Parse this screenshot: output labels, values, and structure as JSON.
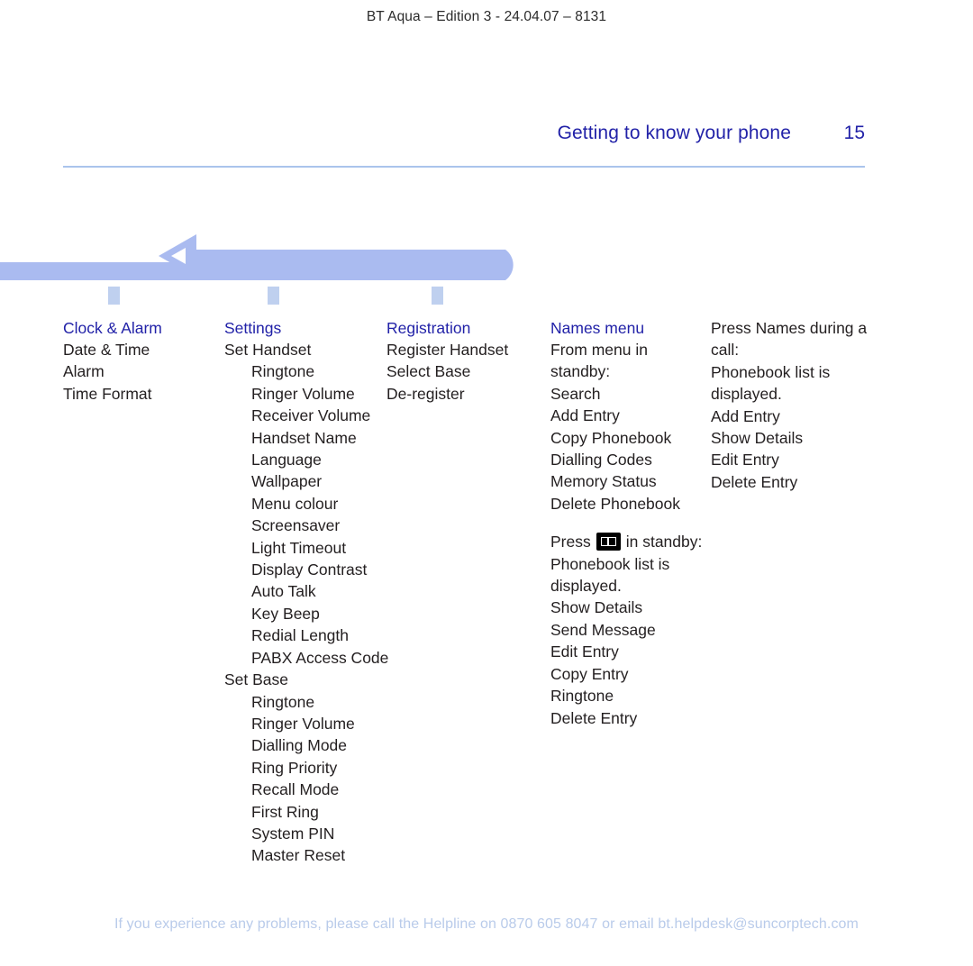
{
  "running_head": "BT Aqua – Edition 3 -  24.04.07 – 8131",
  "header": {
    "chapter_title": "Getting to know your phone",
    "page_number": "15"
  },
  "colors": {
    "heading_blue": "#2222a8",
    "rule_blue": "#aac4ec",
    "arrow_blue": "#aabbf0",
    "tick_blue": "#bfd0ef",
    "footer_blue": "#b9cbea",
    "body_text": "#231f20"
  },
  "columns": [
    {
      "heading": "Clock & Alarm",
      "items": [
        {
          "label": "Date & Time",
          "indent": 0
        },
        {
          "label": "Alarm",
          "indent": 0
        },
        {
          "label": "Time Format",
          "indent": 0
        }
      ]
    },
    {
      "heading": "Settings",
      "items": [
        {
          "label": "Set Handset",
          "indent": 0
        },
        {
          "label": "Ringtone",
          "indent": 1
        },
        {
          "label": "Ringer Volume",
          "indent": 1
        },
        {
          "label": "Receiver Volume",
          "indent": 1
        },
        {
          "label": "Handset Name",
          "indent": 1
        },
        {
          "label": "Language",
          "indent": 1
        },
        {
          "label": "Wallpaper",
          "indent": 1
        },
        {
          "label": "Menu colour",
          "indent": 1
        },
        {
          "label": "Screensaver",
          "indent": 1
        },
        {
          "label": "Light Timeout",
          "indent": 1
        },
        {
          "label": "Display Contrast",
          "indent": 1
        },
        {
          "label": "Auto Talk",
          "indent": 1
        },
        {
          "label": "Key Beep",
          "indent": 1
        },
        {
          "label": "Redial Length",
          "indent": 1
        },
        {
          "label": "PABX Access Code",
          "indent": 1
        },
        {
          "label": "Set Base",
          "indent": 0
        },
        {
          "label": "Ringtone",
          "indent": 1
        },
        {
          "label": "Ringer Volume",
          "indent": 1
        },
        {
          "label": "Dialling Mode",
          "indent": 1
        },
        {
          "label": "Ring Priority",
          "indent": 1
        },
        {
          "label": "Recall Mode",
          "indent": 1
        },
        {
          "label": "First Ring",
          "indent": 1
        },
        {
          "label": "System PIN",
          "indent": 1
        },
        {
          "label": "Master Reset",
          "indent": 1
        }
      ]
    },
    {
      "heading": "Registration",
      "items": [
        {
          "label": "Register Handset",
          "indent": 0
        },
        {
          "label": "Select Base",
          "indent": 0
        },
        {
          "label": "De-register",
          "indent": 0
        }
      ]
    }
  ],
  "names_menu": {
    "heading": "Names menu",
    "standby_intro": "From menu in standby:",
    "standby_items": [
      "Search",
      "Add Entry",
      "Copy Phonebook",
      "Dialling Codes",
      "Memory Status",
      "Delete Phonebook"
    ],
    "press_key": {
      "prefix": "Press",
      "icon": "phonebook-key-icon",
      "suffix": "in standby:",
      "intro": "Phonebook list is displayed.",
      "items": [
        "Show Details",
        "Send Message",
        "Edit Entry",
        "Copy Entry",
        "Ringtone",
        "Delete Entry"
      ]
    }
  },
  "during_call": {
    "intro": "Press Names during a call:",
    "status": "Phonebook list is displayed.",
    "items": [
      "Add Entry",
      "Show Details",
      "Edit Entry",
      "Delete Entry"
    ]
  },
  "footer": "If you experience any problems, please call the Helpline on 0870 605 8047 or email bt.helpdesk@suncorptech.com"
}
